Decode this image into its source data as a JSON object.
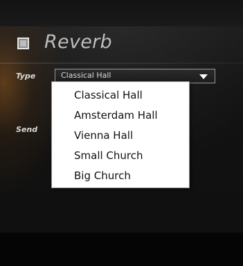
{
  "plugin": {
    "title": "Reverb",
    "type_label": "Type",
    "send_label": "Send",
    "selected_type": "Classical Hall"
  },
  "dropdown": {
    "options": [
      "Classical Hall",
      "Amsterdam Hall",
      "Vienna Hall",
      "Small Church",
      "Big Church"
    ]
  },
  "icons": {
    "toggle": "checkbox-square-icon",
    "arrow": "triangle-down-icon"
  },
  "colors": {
    "title": "#bdbdbd",
    "dropdown_bg": "#ffffff",
    "background": "#121212"
  }
}
